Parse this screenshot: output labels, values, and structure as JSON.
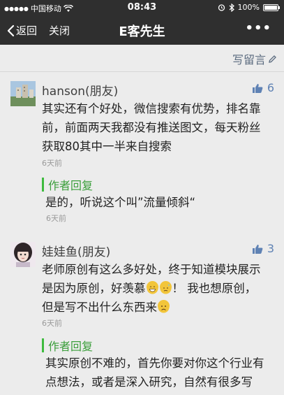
{
  "status_bar": {
    "carrier": "中国移动",
    "time": "08:43",
    "battery_percent": "100%",
    "battery_level": 1.0
  },
  "nav": {
    "back_label": "返回",
    "close_label": "关闭",
    "title": "E客先生",
    "more_label": "•••"
  },
  "write_comment": {
    "label": "写留言"
  },
  "comments": [
    {
      "author": "hanson(朋友)",
      "likes": "6",
      "lines": [
        "其实还有个好处，微信搜索有优势，排名靠",
        "前，前面两天我都没有推送图文，每天粉丝",
        "获取80其中一半来自搜索"
      ],
      "time": "6天前",
      "reply": {
        "label": "作者回复",
        "text": "是的，听说这个叫”流量倾斜“",
        "time": "6天前"
      }
    },
    {
      "author": "娃娃鱼(朋友)",
      "likes": "3",
      "line1": "老师原创有这么多好处，终于知道模块展示",
      "line2_a": "是因为原创，好羡慕",
      "line2_b": "！ 我也想原创，",
      "line3_a": "但是写不出什么东西来",
      "time": "6天前",
      "reply": {
        "label": "作者回复",
        "lines": [
          "其实原创不难的，首先你要对你这个行业有",
          "点想法，或者是深入研究，自然有很多写"
        ]
      }
    }
  ]
}
